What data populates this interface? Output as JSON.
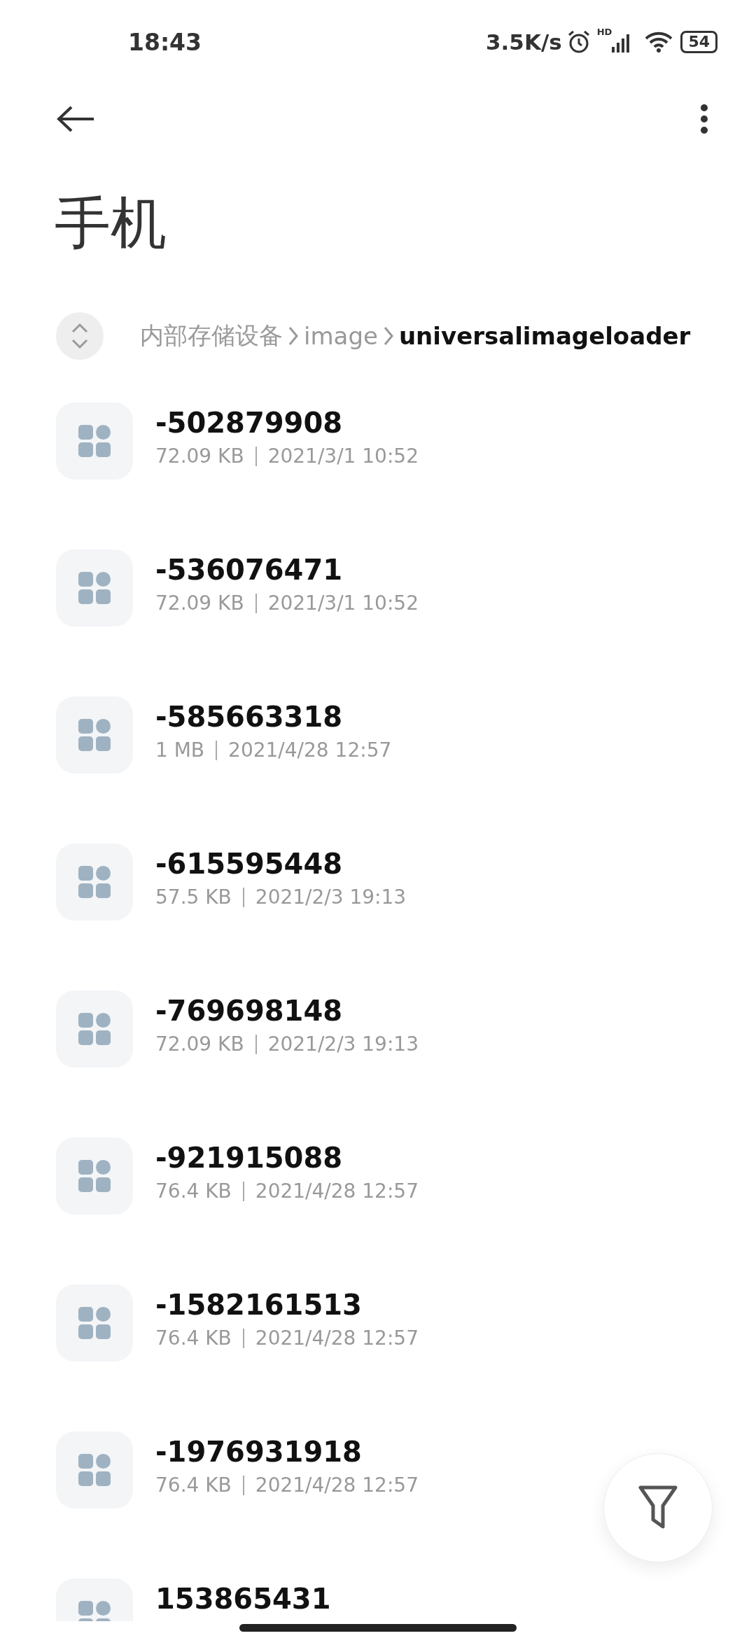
{
  "status_bar": {
    "time": "18:43",
    "net_speed": "3.5K/s",
    "network_label": "HD",
    "battery": "54"
  },
  "title": "手机",
  "breadcrumb": [
    {
      "label": "内部存储设备",
      "selected": false
    },
    {
      "label": "image",
      "selected": false
    },
    {
      "label": "universalimageloader",
      "selected": true
    }
  ],
  "files": [
    {
      "name": "-502879908",
      "size": "72.09 KB",
      "date": "2021/3/1 10:52"
    },
    {
      "name": "-536076471",
      "size": "72.09 KB",
      "date": "2021/3/1 10:52"
    },
    {
      "name": "-585663318",
      "size": "1 MB",
      "date": "2021/4/28 12:57"
    },
    {
      "name": "-615595448",
      "size": "57.5 KB",
      "date": "2021/2/3 19:13"
    },
    {
      "name": "-769698148",
      "size": "72.09 KB",
      "date": "2021/2/3 19:13"
    },
    {
      "name": "-921915088",
      "size": "76.4 KB",
      "date": "2021/4/28 12:57"
    },
    {
      "name": "-1582161513",
      "size": "76.4 KB",
      "date": "2021/4/28 12:57"
    },
    {
      "name": "-1976931918",
      "size": "76.4 KB",
      "date": "2021/4/28 12:57"
    },
    {
      "name": "153865431"
    }
  ]
}
